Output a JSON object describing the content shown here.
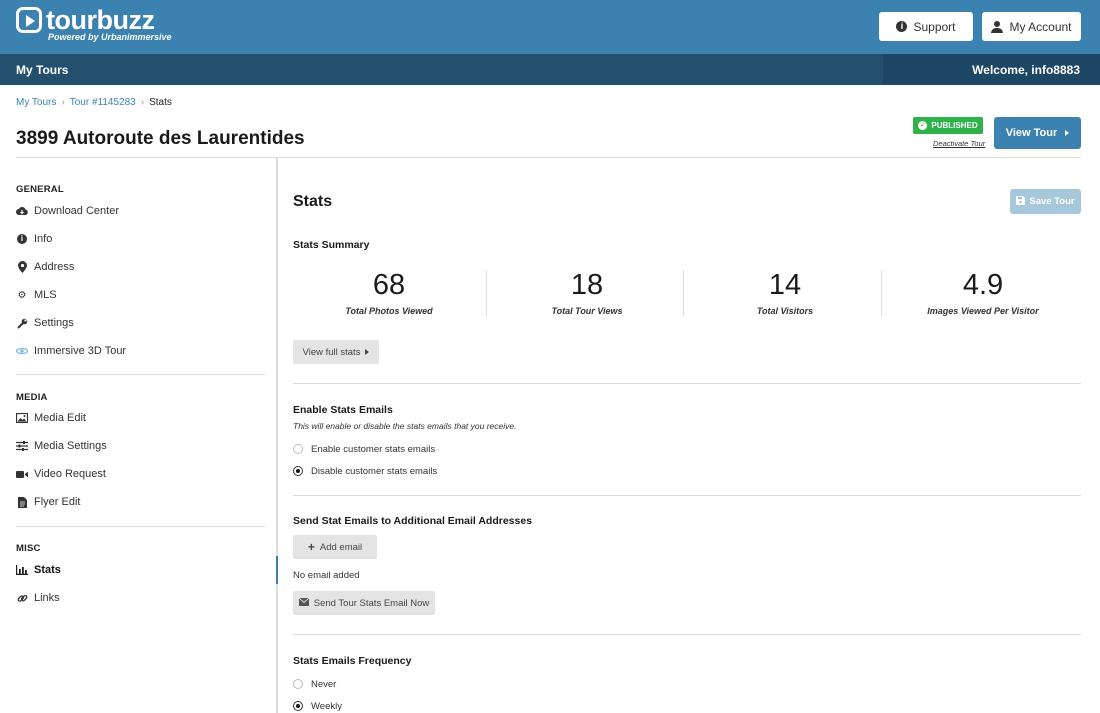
{
  "header": {
    "logo_text": "tourbuzz",
    "logo_sub": "Powered by Urbanimmersive",
    "support_label": "Support",
    "account_label": "My Account"
  },
  "navbar": {
    "title": "My Tours",
    "welcome": "Welcome, info8883"
  },
  "breadcrumb": {
    "items": [
      "My Tours",
      "Tour #1145283",
      "Stats"
    ]
  },
  "page": {
    "title": "3899 Autoroute des Laurentides",
    "status_badge": "PUBLISHED",
    "deactivate_label": "Deactivate Tour",
    "view_tour_label": "View Tour"
  },
  "sidebar": {
    "sections": [
      {
        "title": "GENERAL",
        "items": [
          {
            "label": "Download Center",
            "icon": "cloud-download-icon"
          },
          {
            "label": "Info",
            "icon": "info-icon"
          },
          {
            "label": "Address",
            "icon": "map-marker-icon"
          },
          {
            "label": "MLS",
            "icon": "gear-icon"
          },
          {
            "label": "Settings",
            "icon": "wrench-icon"
          },
          {
            "label": "Immersive 3D Tour",
            "icon": "3d-tour-icon"
          }
        ]
      },
      {
        "title": "MEDIA",
        "items": [
          {
            "label": "Media Edit",
            "icon": "image-icon"
          },
          {
            "label": "Media Settings",
            "icon": "sliders-icon"
          },
          {
            "label": "Video Request",
            "icon": "video-camera-icon"
          },
          {
            "label": "Flyer Edit",
            "icon": "document-icon"
          }
        ]
      },
      {
        "title": "MISC",
        "items": [
          {
            "label": "Stats",
            "icon": "bar-chart-icon",
            "active": true
          },
          {
            "label": "Links",
            "icon": "link-icon"
          }
        ]
      }
    ]
  },
  "main": {
    "title": "Stats",
    "save_label": "Save Tour",
    "summary_title": "Stats Summary",
    "stats": [
      {
        "value": "68",
        "label": "Total Photos Viewed"
      },
      {
        "value": "18",
        "label": "Total Tour Views"
      },
      {
        "value": "14",
        "label": "Total Visitors"
      },
      {
        "value": "4.9",
        "label": "Images Viewed Per Visitor"
      }
    ],
    "view_full_stats_label": "View full stats",
    "emails_section": {
      "title": "Enable Stats Emails",
      "description": "This will enable or disable the stats emails that you receive.",
      "options": [
        {
          "label": "Enable customer stats emails",
          "selected": false
        },
        {
          "label": "Disable customer stats emails",
          "selected": true
        }
      ]
    },
    "additional_section": {
      "title": "Send Stat Emails to Additional Email Addresses",
      "add_email_label": "Add email",
      "no_email_text": "No email added",
      "send_now_label": "Send Tour Stats Email Now"
    },
    "frequency_section": {
      "title": "Stats Emails Frequency",
      "options": [
        {
          "label": "Never",
          "selected": false
        },
        {
          "label": "Weekly",
          "selected": true
        }
      ]
    }
  }
}
